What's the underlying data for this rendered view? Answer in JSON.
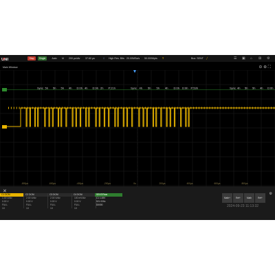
{
  "topbar": {
    "brand_main": "UNI",
    "brand_accent": "-T",
    "run_state": "Stop",
    "acquire_mode": "Single",
    "trigger_mode": "Auto",
    "sample_label": "M",
    "time_scale": "200 μs/div",
    "delay": "37.60 μs",
    "acq_type": "High Res. Bits",
    "sample_rate": "20.00MSa/s",
    "memory_depth": "50.000Mpts",
    "trigger_symbol": "T",
    "bus_label": "Bus: SENT"
  },
  "window": {
    "title": "Main Window"
  },
  "decode": {
    "group1": [
      "Sync",
      "5h",
      "5h",
      "5h",
      "4h",
      "D:0h",
      "4h",
      "D:9h",
      "2h",
      "P:21h"
    ],
    "group2": [
      "Sync",
      "4h",
      "5h",
      "5h",
      "4h",
      "D:0h",
      "D:9h",
      "P:53h"
    ],
    "group3": [
      "Sync",
      "4h",
      "5h",
      "5h",
      "4h",
      "D:0h",
      "2h"
    ]
  },
  "axis_ticks": [
    "-800μs",
    "-600μs",
    "-400μs",
    "-200μs",
    "0s",
    "200μs",
    "400μs",
    "600μs",
    "800μs"
  ],
  "channels": [
    {
      "name": "C1",
      "coupling": "DCM",
      "scale": "1.00 V/div",
      "offset": "0.00 V",
      "bw": "FULL",
      "probe": "1X",
      "color": "#e8b400"
    },
    {
      "name": "C2",
      "coupling": "DCM",
      "scale": "2.00 V/div",
      "offset": "0.00 V",
      "bw": "FULL",
      "probe": "1X",
      "color": "#888888"
    },
    {
      "name": "C3",
      "coupling": "DCM",
      "scale": "2.00 V/div",
      "offset": "0.00 V",
      "bw": "FULL",
      "probe": "1X",
      "color": "#888888"
    },
    {
      "name": "C4",
      "coupling": "DCM",
      "scale": "100 mV/div",
      "offset": "0.00 V",
      "bw": "FULL",
      "probe": "1X",
      "color": "#888888"
    }
  ],
  "trigger": {
    "label": "SENT/Rear",
    "level": "C1 1.00V",
    "freq": "521.00Hz",
    "code": "D0000"
  },
  "softkeys": [
    "Math+",
    "Ref+",
    "Math",
    "Ref+"
  ],
  "clock": "2024-09-23 11:13:32",
  "colors": {
    "accent": "#e8b400",
    "bus": "#2e8b2e",
    "decode": "#cfcfcf"
  }
}
